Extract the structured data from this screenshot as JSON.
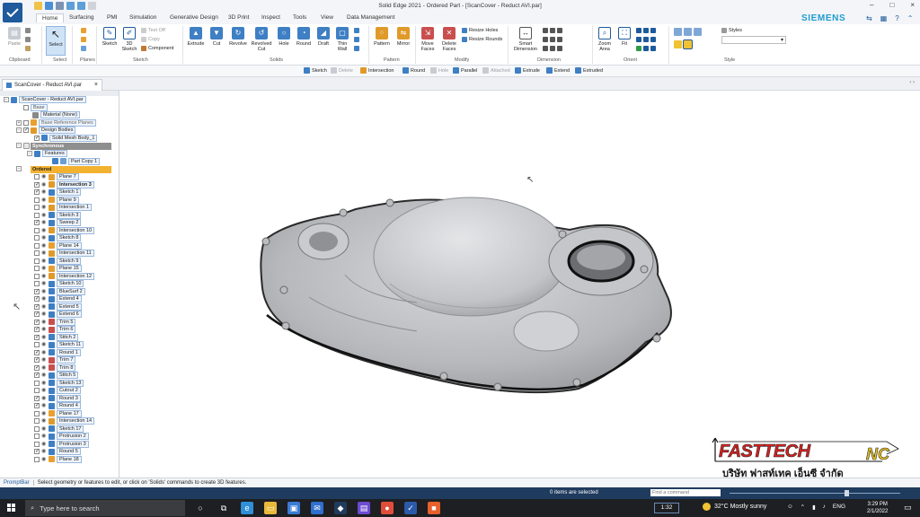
{
  "window": {
    "title": "Solid Edge 2021 - Ordered Part - [ScanCover - Reduct AVI.par]",
    "controls": [
      "–",
      "□",
      "×"
    ]
  },
  "ribbon_tabs": [
    "Home",
    "Surfacing",
    "PMI",
    "Simulation",
    "Generative Design",
    "3D Print",
    "Inspect",
    "Tools",
    "View",
    "Data Management"
  ],
  "brand": "SIEMENS",
  "ribbon": {
    "buttons": [
      "Paste",
      "Select",
      "Sketch",
      "3D Sketch",
      "Extrude",
      "Cut",
      "Revolve",
      "Revolved Cut",
      "Hole",
      "Round",
      "Draft",
      "Thin Wall",
      "Pattern",
      "Mirror",
      "Move Faces",
      "Delete Faces",
      "Smart Dimension",
      "Zoom Area",
      "Fit"
    ],
    "small": [
      "Text Off",
      "Copy",
      "Component",
      "Resize Holes",
      "Resize Rounds",
      "Styles"
    ],
    "groups": [
      "Clipboard",
      "Select",
      "Planes",
      "Sketch",
      "Solids",
      "Pattern",
      "Modify",
      "Dimension",
      "Orient",
      "Style"
    ]
  },
  "command_bar": {
    "items": [
      "Sketch",
      "Delete",
      "Intersection",
      "Round",
      "Hole",
      "Parallel",
      "Attached",
      "Extrude",
      "Extend",
      "Extruded"
    ]
  },
  "doc_tab": {
    "label": "ScanCover - Reduct AVI.par",
    "close": "×",
    "nav": "‹ ›"
  },
  "pathfinder": {
    "root": "ScanCover - Reduct AVI.par",
    "base": "Base",
    "material": "Material (None)",
    "base_ref_planes": "Base Reference Planes",
    "design_bodies": "Design Bodies",
    "solid_body": "Solid Mesh Body_1",
    "synchronous": "Synchronous",
    "features": "Features",
    "part_copy": "Part Copy 1",
    "ordered": "Ordered",
    "items": [
      "Plane 7",
      "Intersection 3",
      "Sketch 1",
      "Plane 9",
      "Intersection 1",
      "Sketch 3",
      "Sweep 2",
      "Intersection 10",
      "Sketch 8",
      "Plane 14",
      "Intersection 11",
      "Sketch 9",
      "Plane 15",
      "Intersection 12",
      "Sketch 10",
      "BlueSurf 2",
      "Extend 4",
      "Extend 5",
      "Extend 6",
      "Trim 5",
      "Trim 6",
      "Stitch 2",
      "Sketch 11",
      "Round 1",
      "Trim 7",
      "Trim 8",
      "Stitch 5",
      "Sketch 13",
      "Cutout 2",
      "Round 3",
      "Round 4",
      "Plane 17",
      "Intersection 14",
      "Sketch 17",
      "Protrusion 2",
      "Protrusion 3",
      "Round 5",
      "Plane 18"
    ]
  },
  "prompt": {
    "label": "PromptBar",
    "text": "Select geometry or features to edit, or click on 'Solids' commands to create 3D features."
  },
  "status": {
    "items_selected": "0 items are selected",
    "find_placeholder": "Find a command"
  },
  "taskbar": {
    "search_placeholder": "Type here to search",
    "recording_time": "1:32",
    "weather": "32°C  Mostly sunny",
    "language": "ENG",
    "time": "3:29 PM",
    "date": "2/1/2022"
  },
  "watermark": {
    "brand": "FASTTECH",
    "suffix": "NC",
    "thai": "บริษัท  ฟาสท์เทค  เอ็นซี  จำกัด"
  },
  "colors": {
    "statusbar": "#1f3b5e",
    "ordered_header": "#f2b230",
    "brand": "#1f9ccf",
    "watermark_red": "#d9201f"
  }
}
